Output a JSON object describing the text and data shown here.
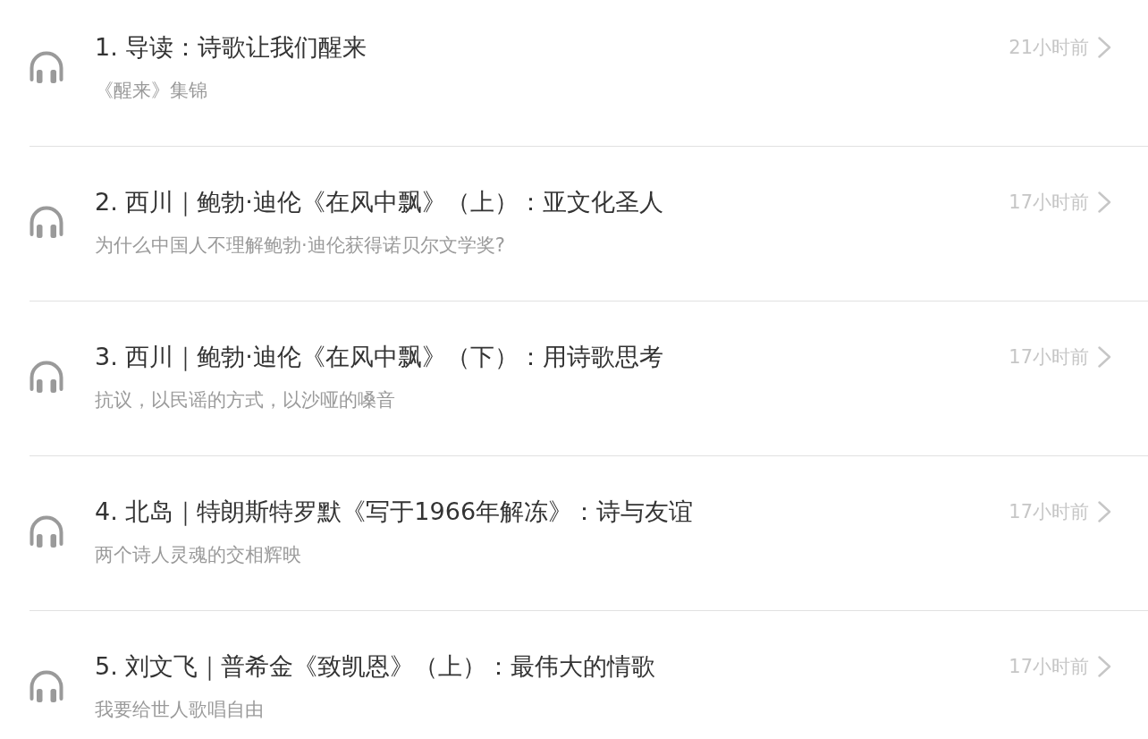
{
  "episodes": [
    {
      "title": "1. 导读：诗歌让我们醒来",
      "subtitle": "《醒来》集锦",
      "time": "21小时前"
    },
    {
      "title": "2. 西川｜鲍勃·迪伦《在风中飘》（上）：亚文化圣人",
      "subtitle": "为什么中国人不理解鲍勃·迪伦获得诺贝尔文学奖?",
      "time": "17小时前"
    },
    {
      "title": "3. 西川｜鲍勃·迪伦《在风中飘》（下）：用诗歌思考",
      "subtitle": "抗议，以民谣的方式，以沙哑的嗓音",
      "time": "17小时前"
    },
    {
      "title": "4. 北岛｜特朗斯特罗默《写于1966年解冻》：诗与友谊",
      "subtitle": "两个诗人灵魂的交相辉映",
      "time": "17小时前"
    },
    {
      "title": "5. 刘文飞｜普希金《致凯恩》（上）：最伟大的情歌",
      "subtitle": "我要给世人歌唱自由",
      "time": "17小时前"
    }
  ]
}
